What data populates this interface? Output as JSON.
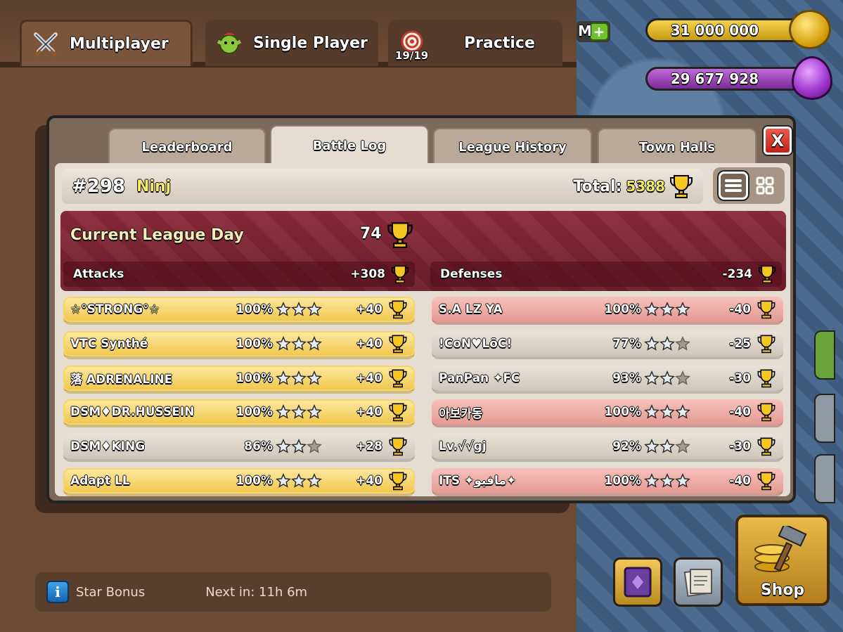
{
  "top_tabs": {
    "multiplayer": "Multiplayer",
    "single_player": "Single Player",
    "practice": "Practice",
    "practice_count": "19/19"
  },
  "resources": {
    "gems_partial": "M",
    "gold": "31 000 000",
    "elixir": "29 677 928"
  },
  "modal": {
    "tabs": [
      "Leaderboard",
      "Battle Log",
      "League History",
      "Town Halls"
    ],
    "active_tab": "Battle Log",
    "close_label": "X",
    "player": {
      "rank": "#298",
      "name": "Ninj",
      "total_label": "Total:",
      "total_value": "5388"
    },
    "league_day": {
      "title": "Current League Day",
      "value": "74",
      "attacks_label": "Attacks",
      "attacks_total": "+308",
      "defenses_label": "Defenses",
      "defenses_total": "-234"
    },
    "attacks": [
      {
        "opponent": "☆°STRONG°☆",
        "percent": "100%",
        "stars": 3,
        "trophies": "+40",
        "style": "gold"
      },
      {
        "opponent": "VTC Synthé",
        "percent": "100%",
        "stars": 3,
        "trophies": "+40",
        "style": "gold"
      },
      {
        "opponent": "落 ADRENALINE",
        "percent": "100%",
        "stars": 3,
        "trophies": "+40",
        "style": "gold"
      },
      {
        "opponent": "DSM♦DR.HUSSEIN",
        "percent": "100%",
        "stars": 3,
        "trophies": "+40",
        "style": "gold"
      },
      {
        "opponent": "DSM♦KING",
        "percent": "86%",
        "stars": 2,
        "trophies": "+28",
        "style": "gray"
      },
      {
        "opponent": "Adapt LL",
        "percent": "100%",
        "stars": 3,
        "trophies": "+40",
        "style": "gold"
      }
    ],
    "defenses": [
      {
        "opponent": "S.A LZ YA",
        "percent": "100%",
        "stars": 3,
        "trophies": "-40",
        "style": "red"
      },
      {
        "opponent": "!CoN♥LōC!",
        "percent": "77%",
        "stars": 2,
        "trophies": "-25",
        "style": "gray"
      },
      {
        "opponent": "PanPan ✦FC",
        "percent": "93%",
        "stars": 2,
        "trophies": "-30",
        "style": "gray"
      },
      {
        "opponent": "아보카동",
        "percent": "100%",
        "stars": 3,
        "trophies": "-40",
        "style": "red"
      },
      {
        "opponent": "Lv.√√gj",
        "percent": "92%",
        "stars": 2,
        "trophies": "-30",
        "style": "gray"
      },
      {
        "opponent": "ITS ✦مافيو✦",
        "percent": "100%",
        "stars": 3,
        "trophies": "-40",
        "style": "red"
      }
    ]
  },
  "bottom": {
    "star_bonus_label": "Star Bonus",
    "next_in": "Next in: 11h 6m",
    "shop_label": "Shop"
  },
  "icons": {
    "multiplayer": "crossed-swords-icon",
    "single_player": "goblin-icon",
    "practice": "target-icon",
    "trophy": "trophy-icon",
    "list_view": "list-view-icon",
    "grid_view": "grid-view-icon",
    "info": "info-icon"
  },
  "colors": {
    "gold_row": "#f1c64a",
    "red_row": "#e49a92",
    "gray_row": "#cfc6b9",
    "league_banner": "#7a2232",
    "highlight_text": "#f2e96a"
  }
}
